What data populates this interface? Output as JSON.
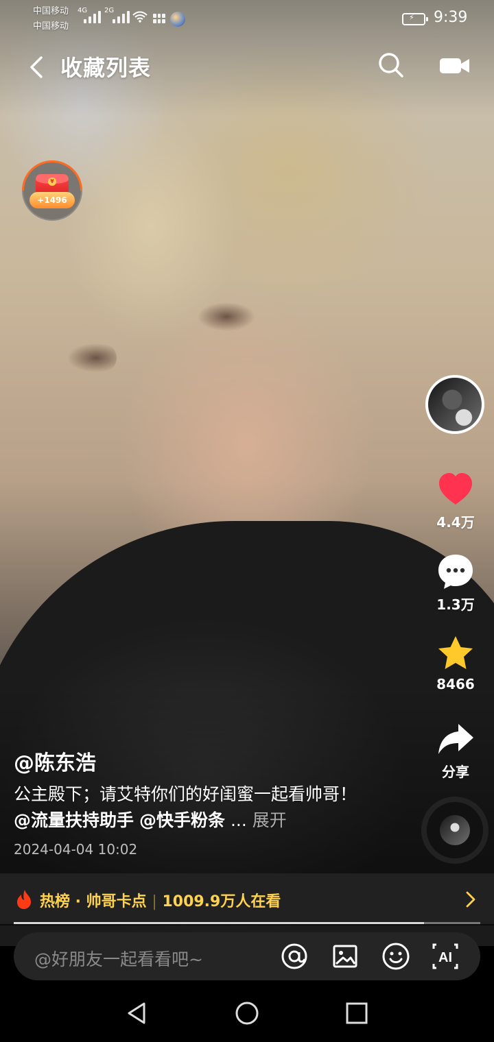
{
  "status_bar": {
    "carrier_top": "中国移动",
    "carrier_bottom": "中国移动",
    "network_1": "4G",
    "network_2": "2G",
    "time": "9:39"
  },
  "header": {
    "title": "收藏列表",
    "back_icon": "back-icon",
    "search_icon": "search-icon",
    "camera_icon": "camera-icon"
  },
  "red_packet": {
    "count": "+1496"
  },
  "actions": {
    "like_count": "4.4万",
    "comment_count": "1.3万",
    "favorite_count": "8466",
    "share_label": "分享"
  },
  "post": {
    "author": "@陈东浩",
    "caption_text": "公主殿下；请艾特你们的好闺蜜一起看帅哥！",
    "tag_1": "@流量扶持助手",
    "tag_2": "@快手粉条",
    "ellipsis": "...",
    "expand_label": "展开",
    "date": "2024-04-04 10:02"
  },
  "hot_bar": {
    "label": "热榜 · 帅哥卡点",
    "separator": "|",
    "viewers": "1009.9万人在看",
    "accent": "#ffd24d"
  },
  "progress": {
    "value": 0.88
  },
  "comment_bar": {
    "placeholder": "@好朋友一起看看吧~"
  },
  "colors": {
    "like": "#ff3350",
    "favorite": "#ffc92b",
    "accent_orange": "#ff6b21"
  }
}
